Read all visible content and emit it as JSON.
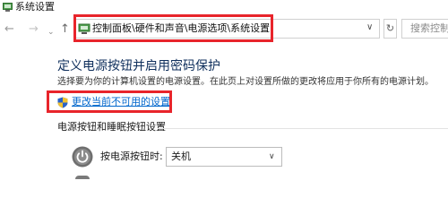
{
  "window": {
    "title": "系统设置"
  },
  "nav": {
    "back_glyph": "←",
    "forward_glyph": "→",
    "history_glyph": "⌄",
    "up_glyph": "↑",
    "refresh_glyph": "↻"
  },
  "address_bar": {
    "path": "控制面板\\硬件和声音\\电源选项\\系统设置",
    "dropdown_glyph": "∨"
  },
  "search": {
    "placeholder": "搜索控制面"
  },
  "content": {
    "heading": "定义电源按钮并启用密码保护",
    "description": "选择要为你的计算机设置的电源设置。在此页上对设置所做的更改将应用于你所有的电源计划。",
    "change_link": "更改当前不可用的设置",
    "section_title": "电源按钮和睡眠按钮设置",
    "power_button": {
      "label": "按电源按钮时:",
      "selected_option": "关机",
      "arrow_glyph": "∨"
    }
  },
  "colors": {
    "highlight": "#e8242b",
    "link": "#0066cc",
    "heading": "#0f2f5c"
  },
  "icons": {
    "app": "control-panel-icon",
    "address": "control-panel-icon",
    "shield": "uac-shield-icon",
    "power": "power-icon"
  }
}
